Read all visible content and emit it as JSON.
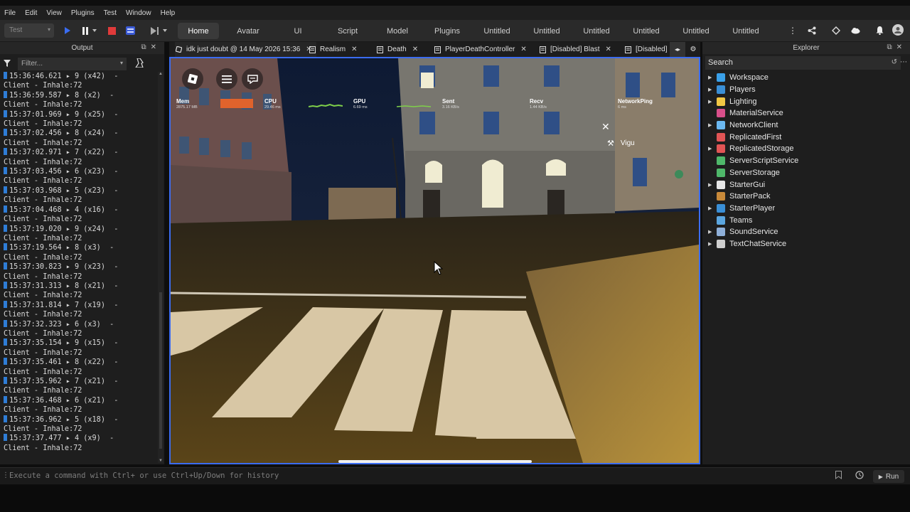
{
  "menu": [
    "File",
    "Edit",
    "View",
    "Plugins",
    "Test",
    "Window",
    "Help"
  ],
  "toolbar": {
    "mode_select": "Test",
    "tabs": [
      "Home",
      "Avatar",
      "UI",
      "Script",
      "Model",
      "Plugins",
      "Untitled",
      "Untitled",
      "Untitled",
      "Untitled",
      "Untitled",
      "Untitled"
    ],
    "active_tab": "Home",
    "colors": {
      "stop": "#e03a3a",
      "play": "#3a6cf0"
    }
  },
  "output": {
    "title": "Output",
    "filter_placeholder": "Filter...",
    "entries": [
      {
        "time": "15:36:46.621",
        "count": "9 (x42)",
        "msg": "Client - Inhale:72"
      },
      {
        "time": "15:36:59.587",
        "count": "8 (x2)",
        "msg": "Client - Inhale:72"
      },
      {
        "time": "15:37:01.969",
        "count": "9 (x25)",
        "msg": "Client - Inhale:72"
      },
      {
        "time": "15:37:02.456",
        "count": "8 (x24)",
        "msg": "Client - Inhale:72"
      },
      {
        "time": "15:37:02.971",
        "count": "7 (x22)",
        "msg": "Client - Inhale:72"
      },
      {
        "time": "15:37:03.456",
        "count": "6 (x23)",
        "msg": "Client - Inhale:72"
      },
      {
        "time": "15:37:03.968",
        "count": "5 (x23)",
        "msg": "Client - Inhale:72"
      },
      {
        "time": "15:37:04.468",
        "count": "4 (x16)",
        "msg": "Client - Inhale:72"
      },
      {
        "time": "15:37:19.020",
        "count": "9 (x24)",
        "msg": "Client - Inhale:72"
      },
      {
        "time": "15:37:19.564",
        "count": "8 (x3)",
        "msg": "Client - Inhale:72"
      },
      {
        "time": "15:37:30.823",
        "count": "9 (x23)",
        "msg": "Client - Inhale:72"
      },
      {
        "time": "15:37:31.313",
        "count": "8 (x21)",
        "msg": "Client - Inhale:72"
      },
      {
        "time": "15:37:31.814",
        "count": "7 (x19)",
        "msg": "Client - Inhale:72"
      },
      {
        "time": "15:37:32.323",
        "count": "6 (x3)",
        "msg": "Client - Inhale:72"
      },
      {
        "time": "15:37:35.154",
        "count": "9 (x15)",
        "msg": "Client - Inhale:72"
      },
      {
        "time": "15:37:35.461",
        "count": "8 (x22)",
        "msg": "Client - Inhale:72"
      },
      {
        "time": "15:37:35.962",
        "count": "7 (x21)",
        "msg": "Client - Inhale:72"
      },
      {
        "time": "15:37:36.468",
        "count": "6 (x21)",
        "msg": "Client - Inhale:72"
      },
      {
        "time": "15:37:36.962",
        "count": "5 (x18)",
        "msg": "Client - Inhale:72"
      },
      {
        "time": "15:37:37.477",
        "count": "4 (x9)",
        "msg": "Client - Inhale:72"
      }
    ]
  },
  "doc_tabs": [
    {
      "label": "idk just doubt @ 14 May 2026 15:36",
      "icon": "game-icon"
    },
    {
      "label": "Realism",
      "icon": "script-icon"
    },
    {
      "label": "Death",
      "icon": "script-icon"
    },
    {
      "label": "PlayerDeathController",
      "icon": "script-icon"
    },
    {
      "label": "[Disabled] Blast",
      "icon": "script-icon"
    },
    {
      "label": "[Disabled]",
      "icon": "script-icon"
    }
  ],
  "viewport": {
    "stats": [
      {
        "name": "Mem",
        "value": "2875.17 MB"
      },
      {
        "name": "CPU",
        "value": "29.46 ms"
      },
      {
        "name": "GPU",
        "value": "6.69 ms"
      },
      {
        "name": "Sent",
        "value": "3.16 KB/s"
      },
      {
        "name": "Recv",
        "value": "1.44 KB/s"
      },
      {
        "name": "NetworkPing",
        "value": "6 ms"
      }
    ],
    "player_name": "Vigu"
  },
  "explorer": {
    "title": "Explorer",
    "search_placeholder": "Search",
    "items": [
      {
        "label": "Workspace",
        "expandable": true,
        "icon": "workspace-icon",
        "color": "#3aa0e8"
      },
      {
        "label": "Players",
        "expandable": true,
        "icon": "players-icon",
        "color": "#3a8fd6"
      },
      {
        "label": "Lighting",
        "expandable": true,
        "icon": "lightbulb-icon",
        "color": "#f2c744"
      },
      {
        "label": "MaterialService",
        "expandable": false,
        "icon": "material-icon",
        "color": "#d94f8a"
      },
      {
        "label": "NetworkClient",
        "expandable": true,
        "icon": "network-icon",
        "color": "#6bb8f0"
      },
      {
        "label": "ReplicatedFirst",
        "expandable": false,
        "icon": "replicated-first-icon",
        "color": "#e25555"
      },
      {
        "label": "ReplicatedStorage",
        "expandable": true,
        "icon": "replicated-storage-icon",
        "color": "#e25555"
      },
      {
        "label": "ServerScriptService",
        "expandable": false,
        "icon": "server-script-icon",
        "color": "#4fb86a"
      },
      {
        "label": "ServerStorage",
        "expandable": false,
        "icon": "server-storage-icon",
        "color": "#4fb86a"
      },
      {
        "label": "StarterGui",
        "expandable": true,
        "icon": "starter-gui-icon",
        "color": "#e6e6e6"
      },
      {
        "label": "StarterPack",
        "expandable": false,
        "icon": "starter-pack-icon",
        "color": "#c98a3a"
      },
      {
        "label": "StarterPlayer",
        "expandable": true,
        "icon": "starter-player-icon",
        "color": "#3a8fd6"
      },
      {
        "label": "Teams",
        "expandable": false,
        "icon": "teams-icon",
        "color": "#5ba6e0"
      },
      {
        "label": "SoundService",
        "expandable": true,
        "icon": "sound-icon",
        "color": "#8fb0d9"
      },
      {
        "label": "TextChatService",
        "expandable": true,
        "icon": "chat-icon",
        "color": "#cfcfcf"
      }
    ]
  },
  "command_bar": {
    "placeholder": "Execute a command with Ctrl+ or use Ctrl+Up/Down for history",
    "run_label": "Run"
  }
}
